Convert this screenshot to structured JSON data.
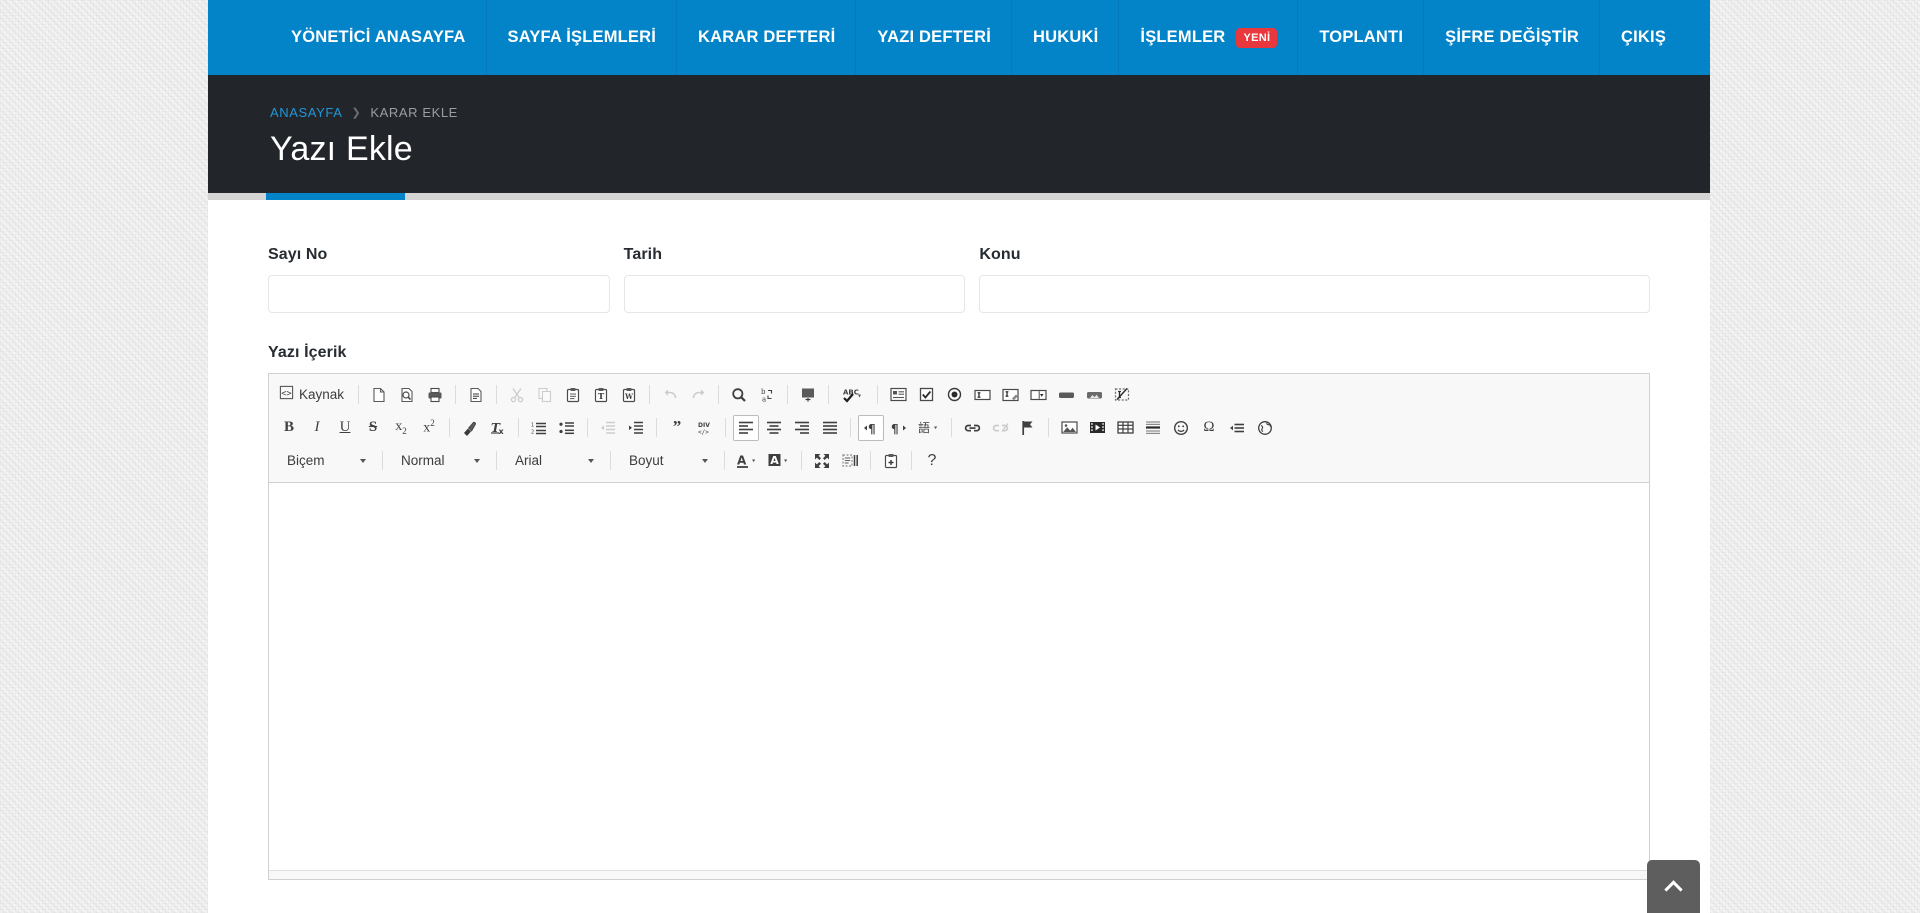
{
  "theme": {
    "nav_blue": "#0484c8",
    "header_dark": "#22262b",
    "badge_red": "#e8373d",
    "link_blue": "#2196d6",
    "page_bg": "#ececec"
  },
  "navbar": {
    "items": [
      {
        "label": "YÖNETİCİ ANASAYFA",
        "badge": null
      },
      {
        "label": "SAYFA İŞLEMLERİ",
        "badge": null
      },
      {
        "label": "KARAR DEFTERİ",
        "badge": null
      },
      {
        "label": "YAZI DEFTERİ",
        "badge": null
      },
      {
        "label": "HUKUKİ",
        "badge": null
      },
      {
        "label": "İŞLEMLER",
        "badge": "YENİ"
      },
      {
        "label": "TOPLANTI",
        "badge": null
      },
      {
        "label": "ŞİFRE DEĞİŞTİR",
        "badge": null
      },
      {
        "label": "ÇIKIŞ",
        "badge": null
      }
    ]
  },
  "header": {
    "breadcrumb": {
      "home": "ANASAYFA",
      "separator": "❯",
      "current": "KARAR EKLE"
    },
    "title": "Yazı Ekle"
  },
  "form": {
    "sayi_no": {
      "label": "Sayı No",
      "value": "",
      "placeholder": ""
    },
    "tarih": {
      "label": "Tarih",
      "value": "",
      "placeholder": ""
    },
    "konu": {
      "label": "Konu",
      "value": "",
      "placeholder": ""
    },
    "icerik": {
      "label": "Yazı İçerik",
      "value": ""
    }
  },
  "editor": {
    "source_label": "Kaynak",
    "row1": [
      {
        "name": "source-icon",
        "title": "Kaynak"
      },
      {
        "name": "new-page-icon",
        "title": "Yeni Sayfa"
      },
      {
        "name": "preview-icon",
        "title": "Önizleme"
      },
      {
        "name": "print-icon",
        "title": "Yazdır"
      },
      {
        "name": "templates-icon",
        "title": "Şablonlar"
      },
      {
        "name": "cut-icon",
        "title": "Kes"
      },
      {
        "name": "copy-icon",
        "title": "Kopyala"
      },
      {
        "name": "paste-icon",
        "title": "Yapıştır"
      },
      {
        "name": "paste-as-text-icon",
        "title": "Düz Metin Olarak Yapıştır"
      },
      {
        "name": "paste-from-word-icon",
        "title": "Word'den Yapıştır"
      },
      {
        "name": "undo-icon",
        "title": "Geri Al"
      },
      {
        "name": "redo-icon",
        "title": "Yinele"
      },
      {
        "name": "find-icon",
        "title": "Bul"
      },
      {
        "name": "replace-icon",
        "title": "Değiştir"
      },
      {
        "name": "select-all-icon",
        "title": "Tümünü Seç"
      },
      {
        "name": "spellcheck-icon",
        "title": "Yazım Denetimi"
      },
      {
        "name": "form-icon",
        "title": "Form"
      },
      {
        "name": "checkbox-icon",
        "title": "Onay Kutusu"
      },
      {
        "name": "radio-button-icon",
        "title": "Seçenek Düğmesi"
      },
      {
        "name": "text-field-icon",
        "title": "Metin Alanı"
      },
      {
        "name": "textarea-icon",
        "title": "Çok Satırlı Metin"
      },
      {
        "name": "select-field-icon",
        "title": "Seçim Alanı"
      },
      {
        "name": "button-icon",
        "title": "Düğme"
      },
      {
        "name": "image-button-icon",
        "title": "Resimli Düğme"
      },
      {
        "name": "hidden-field-icon",
        "title": "Gizli Alan"
      }
    ],
    "row2": [
      {
        "name": "bold-icon",
        "title": "Kalın"
      },
      {
        "name": "italic-icon",
        "title": "İtalik"
      },
      {
        "name": "underline-icon",
        "title": "Altı Çizili"
      },
      {
        "name": "strikethrough-icon",
        "title": "Üstü Çizili"
      },
      {
        "name": "subscript-icon",
        "title": "Alt Simge"
      },
      {
        "name": "superscript-icon",
        "title": "Üst Simge"
      },
      {
        "name": "remove-format-icon",
        "title": "Biçimi Kaldır"
      },
      {
        "name": "clear-formatting-icon",
        "title": "Biçimlendirmeyi Temizle"
      },
      {
        "name": "numbered-list-icon",
        "title": "Numaralı Liste"
      },
      {
        "name": "bulleted-list-icon",
        "title": "Madde İşaretli Liste"
      },
      {
        "name": "outdent-icon",
        "title": "Girintiyi Azalt"
      },
      {
        "name": "indent-icon",
        "title": "Girintiyi Arttır"
      },
      {
        "name": "blockquote-icon",
        "title": "Alıntı"
      },
      {
        "name": "create-div-icon",
        "title": "Div Oluştur"
      },
      {
        "name": "align-left-icon",
        "title": "Sola Hizala"
      },
      {
        "name": "align-center-icon",
        "title": "Ortala"
      },
      {
        "name": "align-right-icon",
        "title": "Sağa Hizala"
      },
      {
        "name": "justify-icon",
        "title": "İki Yana Yasla"
      },
      {
        "name": "text-direction-ltr-icon",
        "title": "Soldan Sağa"
      },
      {
        "name": "text-direction-rtl-icon",
        "title": "Sağdan Sola"
      },
      {
        "name": "language-icon",
        "title": "Dil"
      },
      {
        "name": "link-icon",
        "title": "Köprü"
      },
      {
        "name": "unlink-icon",
        "title": "Köprüyü Kaldır"
      },
      {
        "name": "anchor-icon",
        "title": "Bağlantı Noktası"
      },
      {
        "name": "image-icon",
        "title": "Resim"
      },
      {
        "name": "flash-icon",
        "title": "Flash"
      },
      {
        "name": "table-icon",
        "title": "Tablo"
      },
      {
        "name": "horizontal-rule-icon",
        "title": "Yatay Çizgi"
      },
      {
        "name": "smiley-icon",
        "title": "İfade"
      },
      {
        "name": "special-char-icon",
        "title": "Özel Karakter"
      },
      {
        "name": "page-break-icon",
        "title": "Sayfa Sonu"
      },
      {
        "name": "iframe-icon",
        "title": "IFrame"
      }
    ],
    "combos": [
      {
        "name": "styles-combo",
        "label": "Biçem"
      },
      {
        "name": "format-combo",
        "label": "Normal"
      },
      {
        "name": "font-combo",
        "label": "Arial"
      },
      {
        "name": "size-combo",
        "label": "Boyut"
      }
    ],
    "row3_buttons": [
      {
        "name": "text-color-icon",
        "title": "Metin Rengi"
      },
      {
        "name": "background-color-icon",
        "title": "Arka Plan Rengi"
      },
      {
        "name": "maximize-icon",
        "title": "Büyüt"
      },
      {
        "name": "show-blocks-icon",
        "title": "Blokları Göster"
      },
      {
        "name": "paste-plus-icon",
        "title": "Yapıştır"
      },
      {
        "name": "about-icon",
        "title": "Hakkında"
      }
    ]
  },
  "back_to_top": {
    "label": "Yukarı",
    "icon": "chevron-up-icon"
  }
}
